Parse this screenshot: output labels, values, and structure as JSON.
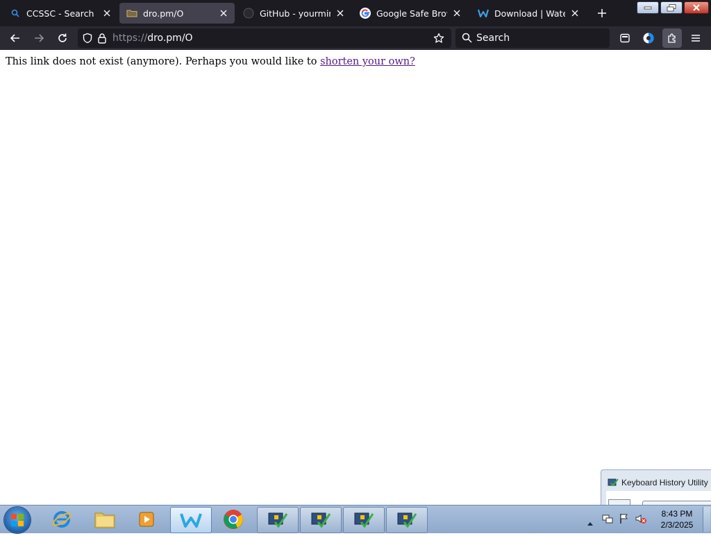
{
  "browser": {
    "tabs": [
      {
        "title": "CCSSC - Search",
        "icon": "search-icon",
        "active": false
      },
      {
        "title": "dro.pm/O",
        "icon": "folder-icon",
        "active": true
      },
      {
        "title": "GitHub - yourminebuilder",
        "icon": "github-icon",
        "active": false
      },
      {
        "title": "Google Safe Browsing",
        "icon": "google-icon",
        "active": false
      },
      {
        "title": "Download | Waterfox",
        "icon": "waterfox-icon",
        "active": false
      }
    ],
    "url_scheme": "https://",
    "url_host": "dro.pm/O",
    "search_placeholder": "Search"
  },
  "page": {
    "message": "This link does not exist (anymore). Perhaps you would like to ",
    "link_text": "shorten your own?"
  },
  "notification": {
    "title": "Keyboard History Utility"
  },
  "taskbar": {
    "time": "8:43 PM",
    "date": "2/3/2025"
  },
  "colors": {
    "tabbar_bg": "#1c1b22",
    "navbar_bg": "#2b2a33",
    "active_tab_bg": "#42414d",
    "visited_link": "#551a8b"
  }
}
